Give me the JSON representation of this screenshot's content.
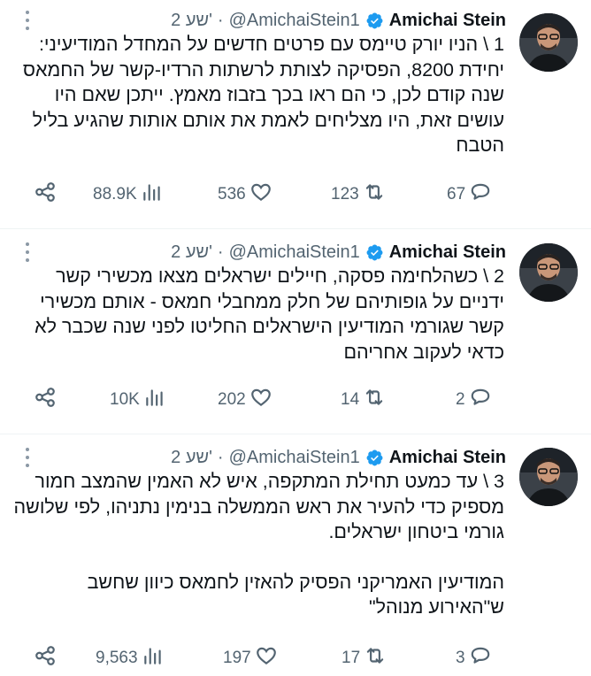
{
  "tweets": [
    {
      "author_name": "Amichai Stein",
      "handle": "@AmichaiStein1",
      "time": "2 שע'",
      "dot": "·",
      "paragraphs": [
        "1 \\ הניו יורק טיימס עם פרטים חדשים על המחדל המודיעיני: יחידת 8200, הפסיקה לצותת לרשתות הרדיו-קשר של החמאס שנה קודם לכן, כי הם ראו בכך בזבוז מאמץ. ייתכן שאם היו עושים זאת, היו מצליחים לאמת את אותם אותות שהגיע בליל הטבח"
      ],
      "views": "88.9K",
      "likes": "536",
      "reposts": "123",
      "replies": "67"
    },
    {
      "author_name": "Amichai Stein",
      "handle": "@AmichaiStein1",
      "time": "2 שע'",
      "dot": "·",
      "paragraphs": [
        "2 \\ כשהלחימה פסקה, חיילים ישראלים מצאו מכשירי קשר ידניים על גופותיהם של חלק ממחבלי חמאס - אותם מכשירי קשר שגורמי המודיעין הישראלים החליטו לפני שנה שכבר לא כדאי לעקוב אחריהם"
      ],
      "views": "10K",
      "likes": "202",
      "reposts": "14",
      "replies": "2"
    },
    {
      "author_name": "Amichai Stein",
      "handle": "@AmichaiStein1",
      "time": "2 שע'",
      "dot": "·",
      "paragraphs": [
        "3 \\ עד כמעט תחילת המתקפה, איש לא האמין שהמצב חמור מספיק כדי להעיר את ראש הממשלה בנימין נתניהו, לפי שלושה גורמי ביטחון ישראלים.",
        "המודיעין האמריקני הפסיק להאזין לחמאס כיוון שחשב ש\"האירוע מנוהל\""
      ],
      "views": "9,563",
      "likes": "197",
      "reposts": "17",
      "replies": "3"
    }
  ],
  "colors": {
    "text": "#0f1419",
    "secondary": "#536471",
    "verified": "#1d9bf0",
    "divider": "#eff3f4"
  },
  "icons": [
    "verified-badge-icon",
    "more-icon",
    "share-icon",
    "views-icon",
    "like-icon",
    "repost-icon",
    "reply-icon"
  ]
}
